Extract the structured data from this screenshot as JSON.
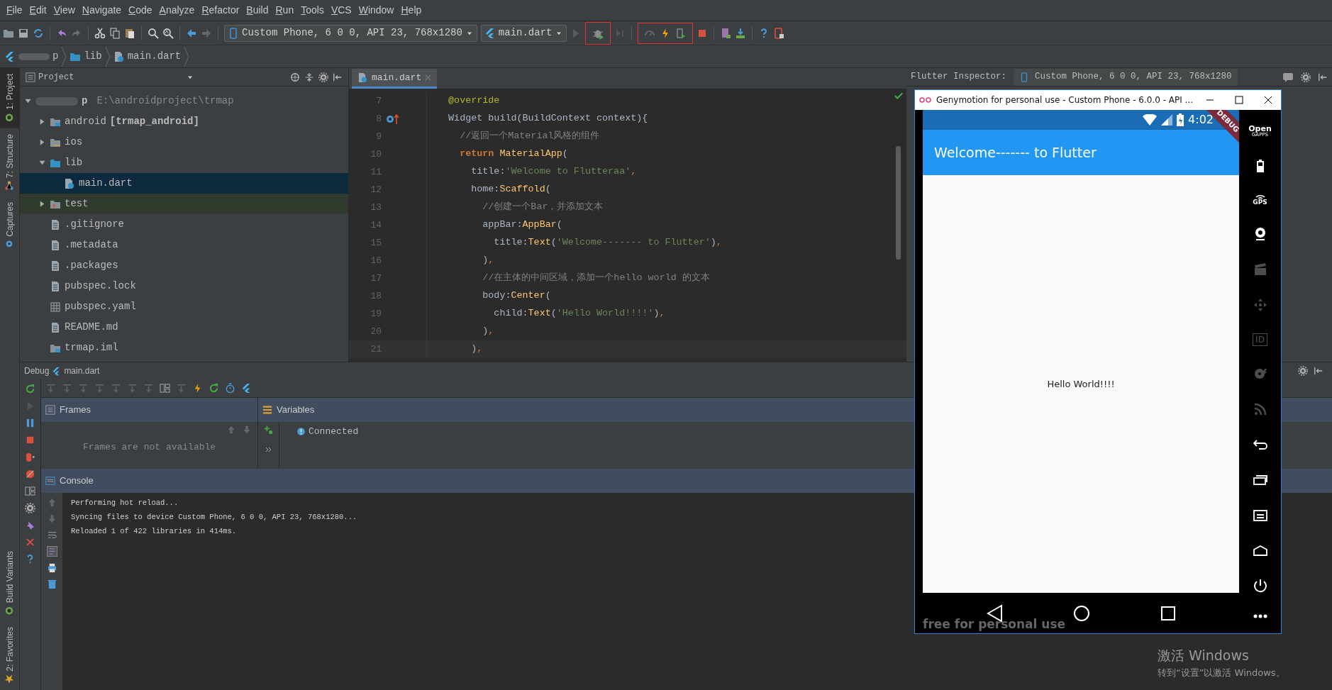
{
  "menu": [
    "File",
    "Edit",
    "View",
    "Navigate",
    "Code",
    "Analyze",
    "Refactor",
    "Build",
    "Run",
    "Tools",
    "VCS",
    "Window",
    "Help"
  ],
  "toolbar": {
    "device": "Custom Phone, 6 0 0, API 23, 768x1280",
    "run_config": "main.dart",
    "debug_highlighted": true,
    "reload_highlighted": true
  },
  "breadcrumb": [
    {
      "kind": "project",
      "label": "p"
    },
    {
      "kind": "folder",
      "label": "lib"
    },
    {
      "kind": "dart",
      "label": "main.dart"
    }
  ],
  "tool_windows_left": [
    {
      "label": "1: Project",
      "selected": true
    },
    {
      "label": "7: Structure",
      "selected": false
    },
    {
      "label": "Captures",
      "selected": false
    }
  ],
  "tool_windows_left_bottom": [
    {
      "label": "Build Variants",
      "selected": false
    },
    {
      "label": "2: Favorites",
      "selected": false
    }
  ],
  "project": {
    "title": "Project",
    "tree": [
      {
        "kind": "root",
        "label": "p",
        "path": "E:\\androidproject\\trmap",
        "expanded": true,
        "selected": false,
        "children": [
          {
            "kind": "module-folder",
            "label": "android",
            "module": "[trmap_android]",
            "expanded": false,
            "selected": false
          },
          {
            "kind": "ios-folder",
            "label": "ios",
            "expanded": false,
            "selected": false
          },
          {
            "kind": "folder",
            "label": "lib",
            "expanded": true,
            "selected": false,
            "children": [
              {
                "kind": "dart",
                "label": "main.dart",
                "selected": true
              }
            ]
          },
          {
            "kind": "test-folder",
            "label": "test",
            "expanded": false,
            "selected": false
          },
          {
            "kind": "file",
            "label": ".gitignore",
            "selected": false
          },
          {
            "kind": "file",
            "label": ".metadata",
            "selected": false
          },
          {
            "kind": "file",
            "label": ".packages",
            "selected": false
          },
          {
            "kind": "file",
            "label": "pubspec.lock",
            "selected": false
          },
          {
            "kind": "table",
            "label": "pubspec.yaml",
            "selected": false
          },
          {
            "kind": "file",
            "label": "README.md",
            "selected": false
          },
          {
            "kind": "module-file",
            "label": "trmap.iml",
            "selected": false
          }
        ]
      }
    ]
  },
  "editor": {
    "tabs": [
      {
        "label": "main.dart",
        "selected": true
      }
    ],
    "lines": [
      {
        "number": "7",
        "current": false,
        "override_marker": false,
        "tokens": [
          {
            "kind": "annotation",
            "s": "  @override"
          }
        ]
      },
      {
        "number": "8",
        "current": false,
        "override_marker": true,
        "tokens": [
          {
            "kind": "plain",
            "s": "  Widget build(BuildContext context){"
          }
        ]
      },
      {
        "number": "9",
        "current": false,
        "override_marker": false,
        "tokens": [
          {
            "kind": "comment",
            "s": "    //返回一个Material风格的组件"
          }
        ]
      },
      {
        "number": "10",
        "current": false,
        "override_marker": false,
        "tokens": [
          {
            "kind": "keyword",
            "s": "    return "
          },
          {
            "kind": "class",
            "s": "MaterialApp"
          },
          {
            "kind": "plain",
            "s": "("
          }
        ]
      },
      {
        "number": "11",
        "current": false,
        "override_marker": false,
        "tokens": [
          {
            "kind": "plain",
            "s": "      title:"
          },
          {
            "kind": "string",
            "s": "'Welcome to Flutteraa'"
          },
          {
            "kind": "punct",
            "s": ","
          }
        ]
      },
      {
        "number": "12",
        "current": false,
        "override_marker": false,
        "tokens": [
          {
            "kind": "plain",
            "s": "      home:"
          },
          {
            "kind": "class",
            "s": "Scaffold"
          },
          {
            "kind": "plain",
            "s": "("
          }
        ]
      },
      {
        "number": "13",
        "current": false,
        "override_marker": false,
        "tokens": [
          {
            "kind": "comment",
            "s": "        //创建一个Bar，并添加文本"
          }
        ]
      },
      {
        "number": "14",
        "current": false,
        "override_marker": false,
        "tokens": [
          {
            "kind": "plain",
            "s": "        appBar:"
          },
          {
            "kind": "class",
            "s": "AppBar"
          },
          {
            "kind": "plain",
            "s": "("
          }
        ]
      },
      {
        "number": "15",
        "current": false,
        "override_marker": false,
        "tokens": [
          {
            "kind": "plain",
            "s": "          title:"
          },
          {
            "kind": "class",
            "s": "Text"
          },
          {
            "kind": "plain",
            "s": "("
          },
          {
            "kind": "string",
            "s": "'Welcome------- to Flutter'"
          },
          {
            "kind": "plain",
            "s": ")"
          },
          {
            "kind": "punct",
            "s": ","
          }
        ]
      },
      {
        "number": "16",
        "current": false,
        "override_marker": false,
        "tokens": [
          {
            "kind": "plain",
            "s": "        )"
          },
          {
            "kind": "punct",
            "s": ","
          }
        ]
      },
      {
        "number": "17",
        "current": false,
        "override_marker": false,
        "tokens": [
          {
            "kind": "comment",
            "s": "        //在主体的中间区域，添加一个hello world 的文本"
          }
        ]
      },
      {
        "number": "18",
        "current": false,
        "override_marker": false,
        "tokens": [
          {
            "kind": "plain",
            "s": "        body:"
          },
          {
            "kind": "class",
            "s": "Center"
          },
          {
            "kind": "plain",
            "s": "("
          }
        ]
      },
      {
        "number": "19",
        "current": false,
        "override_marker": false,
        "tokens": [
          {
            "kind": "plain",
            "s": "          child:"
          },
          {
            "kind": "class",
            "s": "Text"
          },
          {
            "kind": "plain",
            "s": "("
          },
          {
            "kind": "string",
            "s": "'Hello World!!!!'"
          },
          {
            "kind": "plain",
            "s": ")"
          },
          {
            "kind": "punct",
            "s": ","
          }
        ]
      },
      {
        "number": "20",
        "current": false,
        "override_marker": false,
        "tokens": [
          {
            "kind": "plain",
            "s": "        )"
          },
          {
            "kind": "punct",
            "s": ","
          }
        ]
      },
      {
        "number": "21",
        "current": true,
        "override_marker": false,
        "tokens": [
          {
            "kind": "plain",
            "s": "      )"
          },
          {
            "kind": "punct",
            "s": ","
          }
        ]
      }
    ]
  },
  "flutter_inspector": {
    "title": "Flutter Inspector:",
    "device": "Custom Phone, 6 0 0, API 23, 768x1280"
  },
  "debug": {
    "title": "Debug",
    "config": "main.dart",
    "frames_title": "Frames",
    "frames_empty": "Frames are not available",
    "variables_title": "Variables",
    "variables": [
      {
        "kind": "info",
        "text": "Connected"
      }
    ],
    "console_title": "Console",
    "console": [
      "Performing hot reload...",
      "Syncing files to device Custom Phone, 6 0 0, API 23, 768x1280...",
      "Reloaded 1 of 422 libraries in 414ms."
    ]
  },
  "genymotion": {
    "title": "Genymotion for personal use - Custom Phone - 6.0.0 - API ...",
    "status_time": "4:02",
    "debug_banner": "DEBUG",
    "app_title": "Welcome------- to Flutter",
    "body_text": "Hello World!!!!",
    "overlay": "free for personal use",
    "sidebar": [
      {
        "kind": "gapps",
        "label": "Open",
        "sublabel": "GAPPS",
        "disabled": false
      },
      {
        "kind": "battery",
        "disabled": false
      },
      {
        "kind": "gps",
        "label": "GPS",
        "disabled": false
      },
      {
        "kind": "webcam",
        "disabled": false
      },
      {
        "kind": "capture",
        "disabled": true
      },
      {
        "kind": "dpad",
        "disabled": true
      },
      {
        "kind": "id",
        "label": "ID",
        "disabled": true
      },
      {
        "kind": "disk",
        "disabled": true
      },
      {
        "kind": "cast",
        "disabled": true
      },
      {
        "kind": "back",
        "disabled": false
      },
      {
        "kind": "recent",
        "disabled": false
      },
      {
        "kind": "menu",
        "disabled": false
      },
      {
        "kind": "home",
        "disabled": false
      },
      {
        "kind": "power",
        "disabled": false
      },
      {
        "kind": "more",
        "disabled": false
      }
    ]
  },
  "os_watermark": {
    "title": "激活 Windows",
    "subtitle": "转到“设置”以激活 Windows。"
  }
}
